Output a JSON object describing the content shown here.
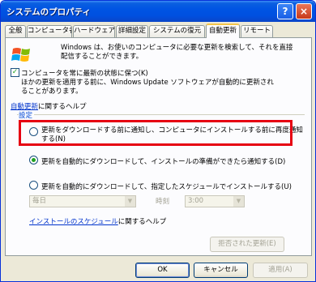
{
  "window": {
    "title": "システムのプロパティ",
    "help_glyph": "?",
    "close_glyph": "×"
  },
  "tabs": [
    {
      "label": "全般"
    },
    {
      "label": "コンピュータ名"
    },
    {
      "label": "ハードウェア"
    },
    {
      "label": "詳細設定"
    },
    {
      "label": "システムの復元"
    },
    {
      "label": "自動更新",
      "active": true
    },
    {
      "label": "リモート"
    }
  ],
  "intro": {
    "line1": "Windows は、お使いのコンピュータに必要な更新を検索して、それを直接",
    "line2": "配信することができます。"
  },
  "keep_updated": {
    "checked": true,
    "line1": "コンピュータを常に最新の状態に保つ(K)",
    "line2": "ほかの更新を適用する前に、Windows Update ソフトウェアが自動的に更新され",
    "line3": "ることがあります。"
  },
  "help_link": {
    "link": "自動更新",
    "rest": "に関するヘルプ"
  },
  "settings_label": "設定",
  "options": {
    "opt1_line1": "更新をダウンロードする前に通知し、コンピュータにインストールする前に再度通知",
    "opt1_line2": "する(N)",
    "opt2": "更新を自動的にダウンロードして、インストールの準備ができたら通知する(D)",
    "opt3": "更新を自動的にダウンロードして、指定したスケジュールでインストールする(U)",
    "selected": "opt2"
  },
  "schedule": {
    "day": "毎日",
    "time_label": "時刻",
    "time": "3:00"
  },
  "schedule_link": {
    "link": "インストールのスケジュール",
    "rest": "に関するヘルプ"
  },
  "declined_button": "拒否された更新(E)",
  "buttons": {
    "ok": "OK",
    "cancel": "キャンセル",
    "apply": "適用(A)"
  },
  "colors": {
    "titlebar": "#0054e3",
    "highlight_box": "#e60012",
    "link": "#0033cc",
    "tab_accent": "#f3c54a"
  }
}
